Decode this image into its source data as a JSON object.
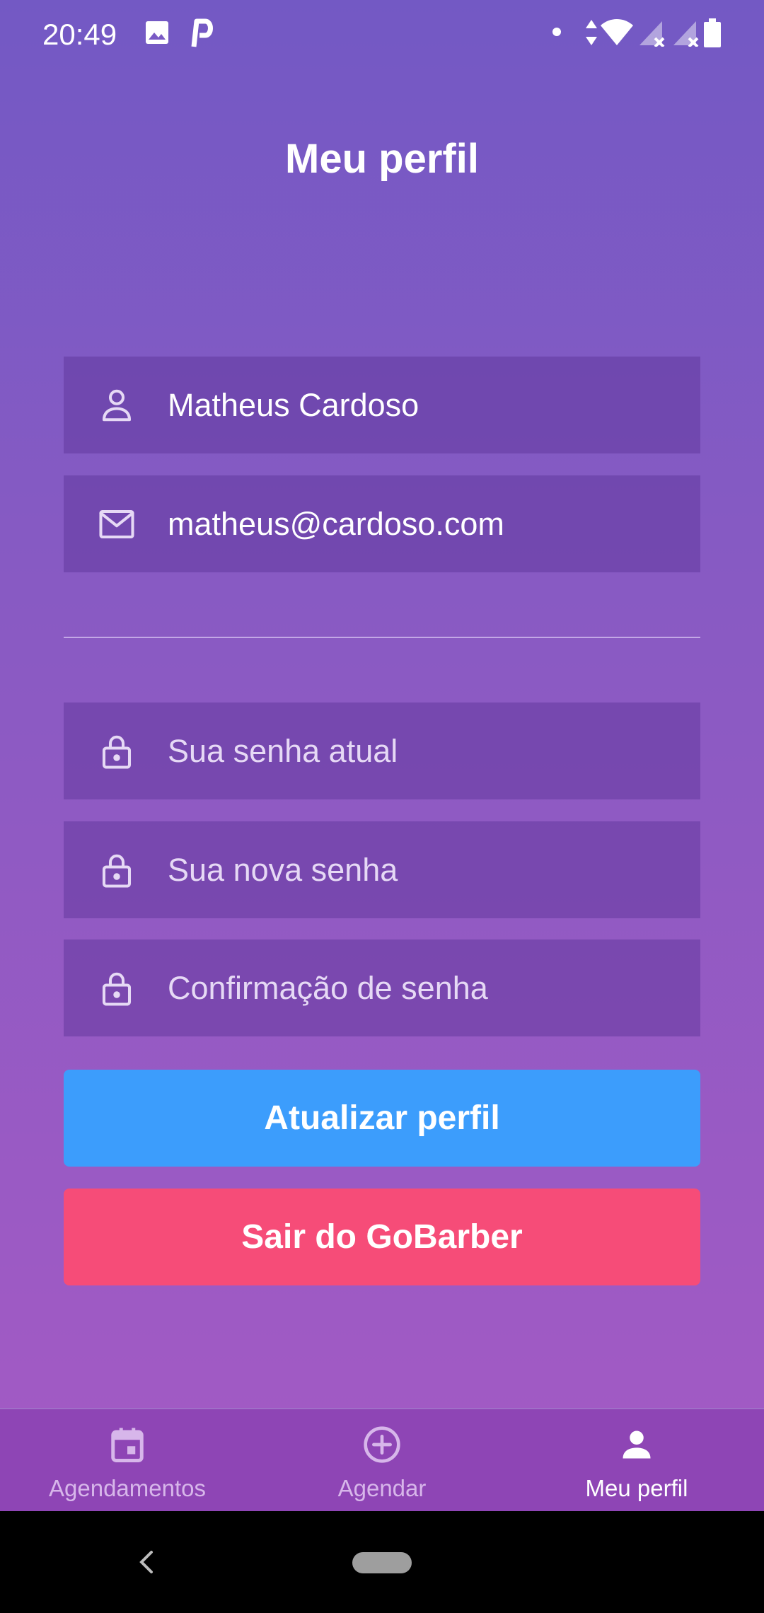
{
  "status_bar": {
    "time": "20:49",
    "icons": [
      "image-icon",
      "parking-icon",
      "dot-icon",
      "data-arrows-icon",
      "wifi-icon",
      "signal-no-service-icon",
      "signal-no-service-icon",
      "battery-icon"
    ]
  },
  "page": {
    "title": "Meu perfil"
  },
  "form": {
    "name": {
      "value": "Matheus Cardoso",
      "icon": "user-icon"
    },
    "email": {
      "value": "matheus@cardoso.com",
      "icon": "mail-icon"
    },
    "current_password": {
      "placeholder": "Sua senha atual",
      "icon": "lock-icon"
    },
    "new_password": {
      "placeholder": "Sua nova senha",
      "icon": "lock-icon"
    },
    "confirm_password": {
      "placeholder": "Confirmação de senha",
      "icon": "lock-icon"
    }
  },
  "buttons": {
    "update": "Atualizar perfil",
    "logout": "Sair do GoBarber"
  },
  "bottom_nav": {
    "items": [
      {
        "label": "Agendamentos",
        "icon": "calendar-icon",
        "active": false
      },
      {
        "label": "Agendar",
        "icon": "add-circle-icon",
        "active": false
      },
      {
        "label": "Meu perfil",
        "icon": "person-icon",
        "active": true
      }
    ]
  },
  "colors": {
    "gradient_top": "#7359c4",
    "gradient_bottom": "#a75ac4",
    "update_button": "#3c9dfc",
    "logout_button": "#f64c78",
    "bottom_nav_bg": "#8e45b5"
  }
}
